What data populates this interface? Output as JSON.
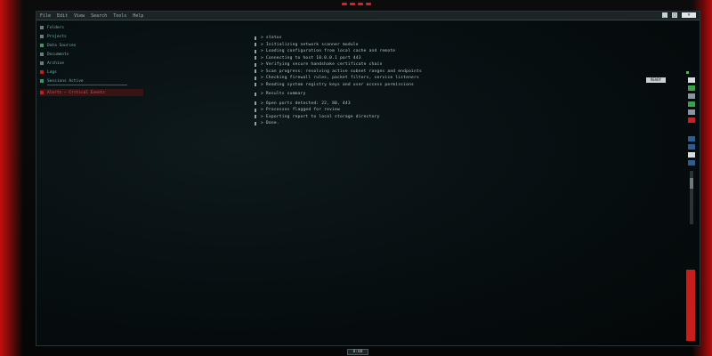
{
  "window": {
    "menu": [
      "File",
      "Edit",
      "View",
      "Search",
      "Tools",
      "Help"
    ],
    "controls": [
      "_",
      "□",
      "×"
    ]
  },
  "sidebar": {
    "items": [
      {
        "label": "Folders",
        "icon": "folder-icon",
        "color": "gray"
      },
      {
        "label": "Projects",
        "icon": "folder-icon",
        "color": "gray"
      },
      {
        "label": "Data Sources",
        "icon": "database-icon",
        "color": "green"
      },
      {
        "label": "Documents",
        "icon": "document-icon",
        "color": "gray"
      },
      {
        "label": "Archive",
        "icon": "archive-icon",
        "color": "gray"
      },
      {
        "label": "Logs",
        "icon": "log-icon",
        "color": "red"
      },
      {
        "label": "Sessions Active",
        "icon": "session-icon",
        "color": "green"
      },
      {
        "label": "Alerts — Critical Events",
        "icon": "alert-icon",
        "color": "red",
        "selected": true
      }
    ]
  },
  "log": {
    "lines": [
      "> status",
      "> Initializing network scanner module",
      "> Loading configuration from local cache and remote",
      "> Connecting to host 10.0.0.1 port 443",
      "> Verifying secure handshake certificate chain",
      "> Scan progress: resolving active subnet ranges and endpoints",
      "> Checking firewall rules, packet filters, service listeners",
      "> Reading system registry keys and user access permissions",
      "",
      "> Results summary",
      "> Open ports detected: 22, 80, 443",
      "> Processes flagged for review",
      "> Exporting report to local storage directory",
      "> Done."
    ]
  },
  "status_chip": "READY",
  "footer_label": "0:00",
  "colors": {
    "accent_red": "#c61d1d",
    "accent_green": "#34c24a",
    "text": "#b8c6c8",
    "teal": "#6fb7b0"
  }
}
